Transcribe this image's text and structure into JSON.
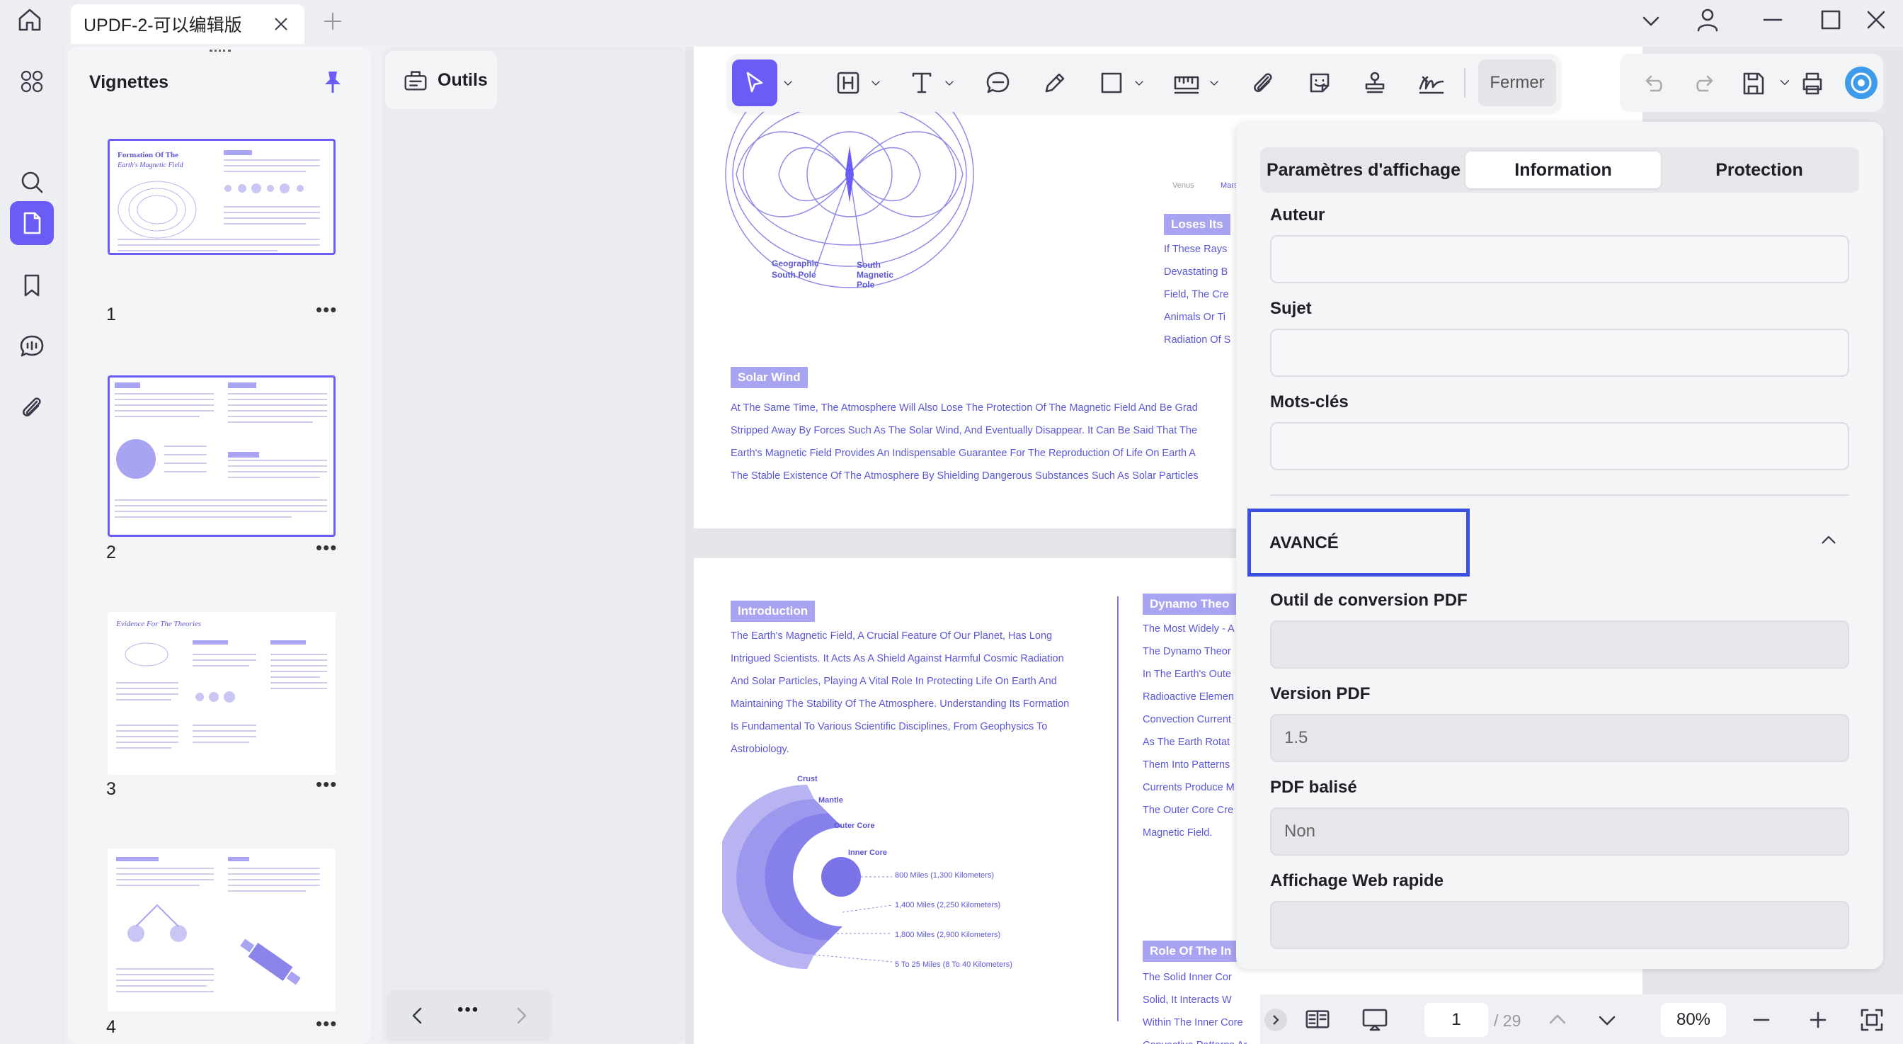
{
  "titlebar": {
    "tab_title": "UPDF-2-可以编辑版"
  },
  "sidebar": {
    "thumbnails_title": "Vignettes",
    "tools_label": "Outils"
  },
  "thumbnails": [
    {
      "page": "1"
    },
    {
      "page": "2"
    },
    {
      "page": "3"
    },
    {
      "page": "4"
    }
  ],
  "toolbar": {
    "close_label": "Fermer"
  },
  "document": {
    "page1": {
      "diagram_labels": {
        "geo_south": "Geographic\nSouth Pole",
        "south_mag": "South\nMagnetic\nPole",
        "venus": "Venus",
        "mars": "Mars"
      },
      "loses_label": "Loses Its",
      "right_lines": [
        "If These Rays",
        "Devastating B",
        "Field, The Cre",
        "Animals Or Ti",
        "Radiation Of S"
      ],
      "solar_wind_label": "Solar Wind",
      "solar_lines": [
        "At The Same Time, The Atmosphere Will Also Lose The Protection Of The Magnetic Field And Be Grad",
        "Stripped Away By Forces Such As The Solar Wind, And Eventually Disappear. It Can Be Said That The",
        "Earth's Magnetic Field Provides An Indispensable Guarantee For The Reproduction Of Life On Earth A",
        "The Stable Existence Of The Atmosphere By Shielding Dangerous Substances Such As Solar Particles"
      ]
    },
    "page2": {
      "intro_label": "Introduction",
      "intro_lines": [
        "The Earth's Magnetic Field, A Crucial Feature Of Our Planet, Has Long",
        "Intrigued Scientists. It Acts As A Shield Against Harmful Cosmic Radiation",
        "And Solar Particles, Playing A Vital Role In Protecting Life On Earth And",
        "Maintaining The Stability Of The Atmosphere. Understanding Its Formation",
        "Is Fundamental To Various Scientific Disciplines, From Geophysics To",
        "Astrobiology."
      ],
      "layers": [
        "Crust",
        "Mantle",
        "Outer Core",
        "Inner Core"
      ],
      "depths": [
        "800 Miles (1,300 Kilometers)",
        "1,400 Miles (2,250 Kilometers)",
        "1,800 Miles (2,900 Kilometers)",
        "5 To 25 Miles (8 To 40 Kilometers)"
      ],
      "dynamo_label": "Dynamo Theo",
      "dynamo_lines": [
        "The Most Widely - A",
        "The Dynamo Theor",
        "In The Earth's Oute",
        "Radioactive Elemen",
        "Convection Current",
        "As The Earth Rotat",
        "Them Into Patterns",
        "Currents Produce M",
        "The Outer Core Cre",
        "Magnetic Field."
      ],
      "role_label": "Role Of The In",
      "role_lines": [
        "The Solid Inner Cor",
        "Solid, It Interacts W",
        "Within The Inner Core",
        "Convective Patterns Ar"
      ]
    }
  },
  "properties": {
    "tabs": [
      "Paramètres d'affichage",
      "Information",
      "Protection"
    ],
    "active_tab": "Information",
    "author_label": "Auteur",
    "author_value": "",
    "subject_label": "Sujet",
    "subject_value": "",
    "keywords_label": "Mots-clés",
    "keywords_value": "",
    "advanced_label": "AVANCÉ",
    "converter_label": "Outil de conversion PDF",
    "converter_value": "",
    "version_label": "Version PDF",
    "version_value": "1.5",
    "tagged_label": "PDF balisé",
    "tagged_value": "Non",
    "fastweb_label": "Affichage Web rapide",
    "fastweb_value": ""
  },
  "statusbar": {
    "current_page": "1",
    "total_pages": "/ 29",
    "zoom": "80%"
  },
  "colors": {
    "accent": "#6b5cf6",
    "highlight_border": "#3b50e0",
    "doc_text": "#5b57d6",
    "doc_label_bg": "#a9a4f2"
  }
}
